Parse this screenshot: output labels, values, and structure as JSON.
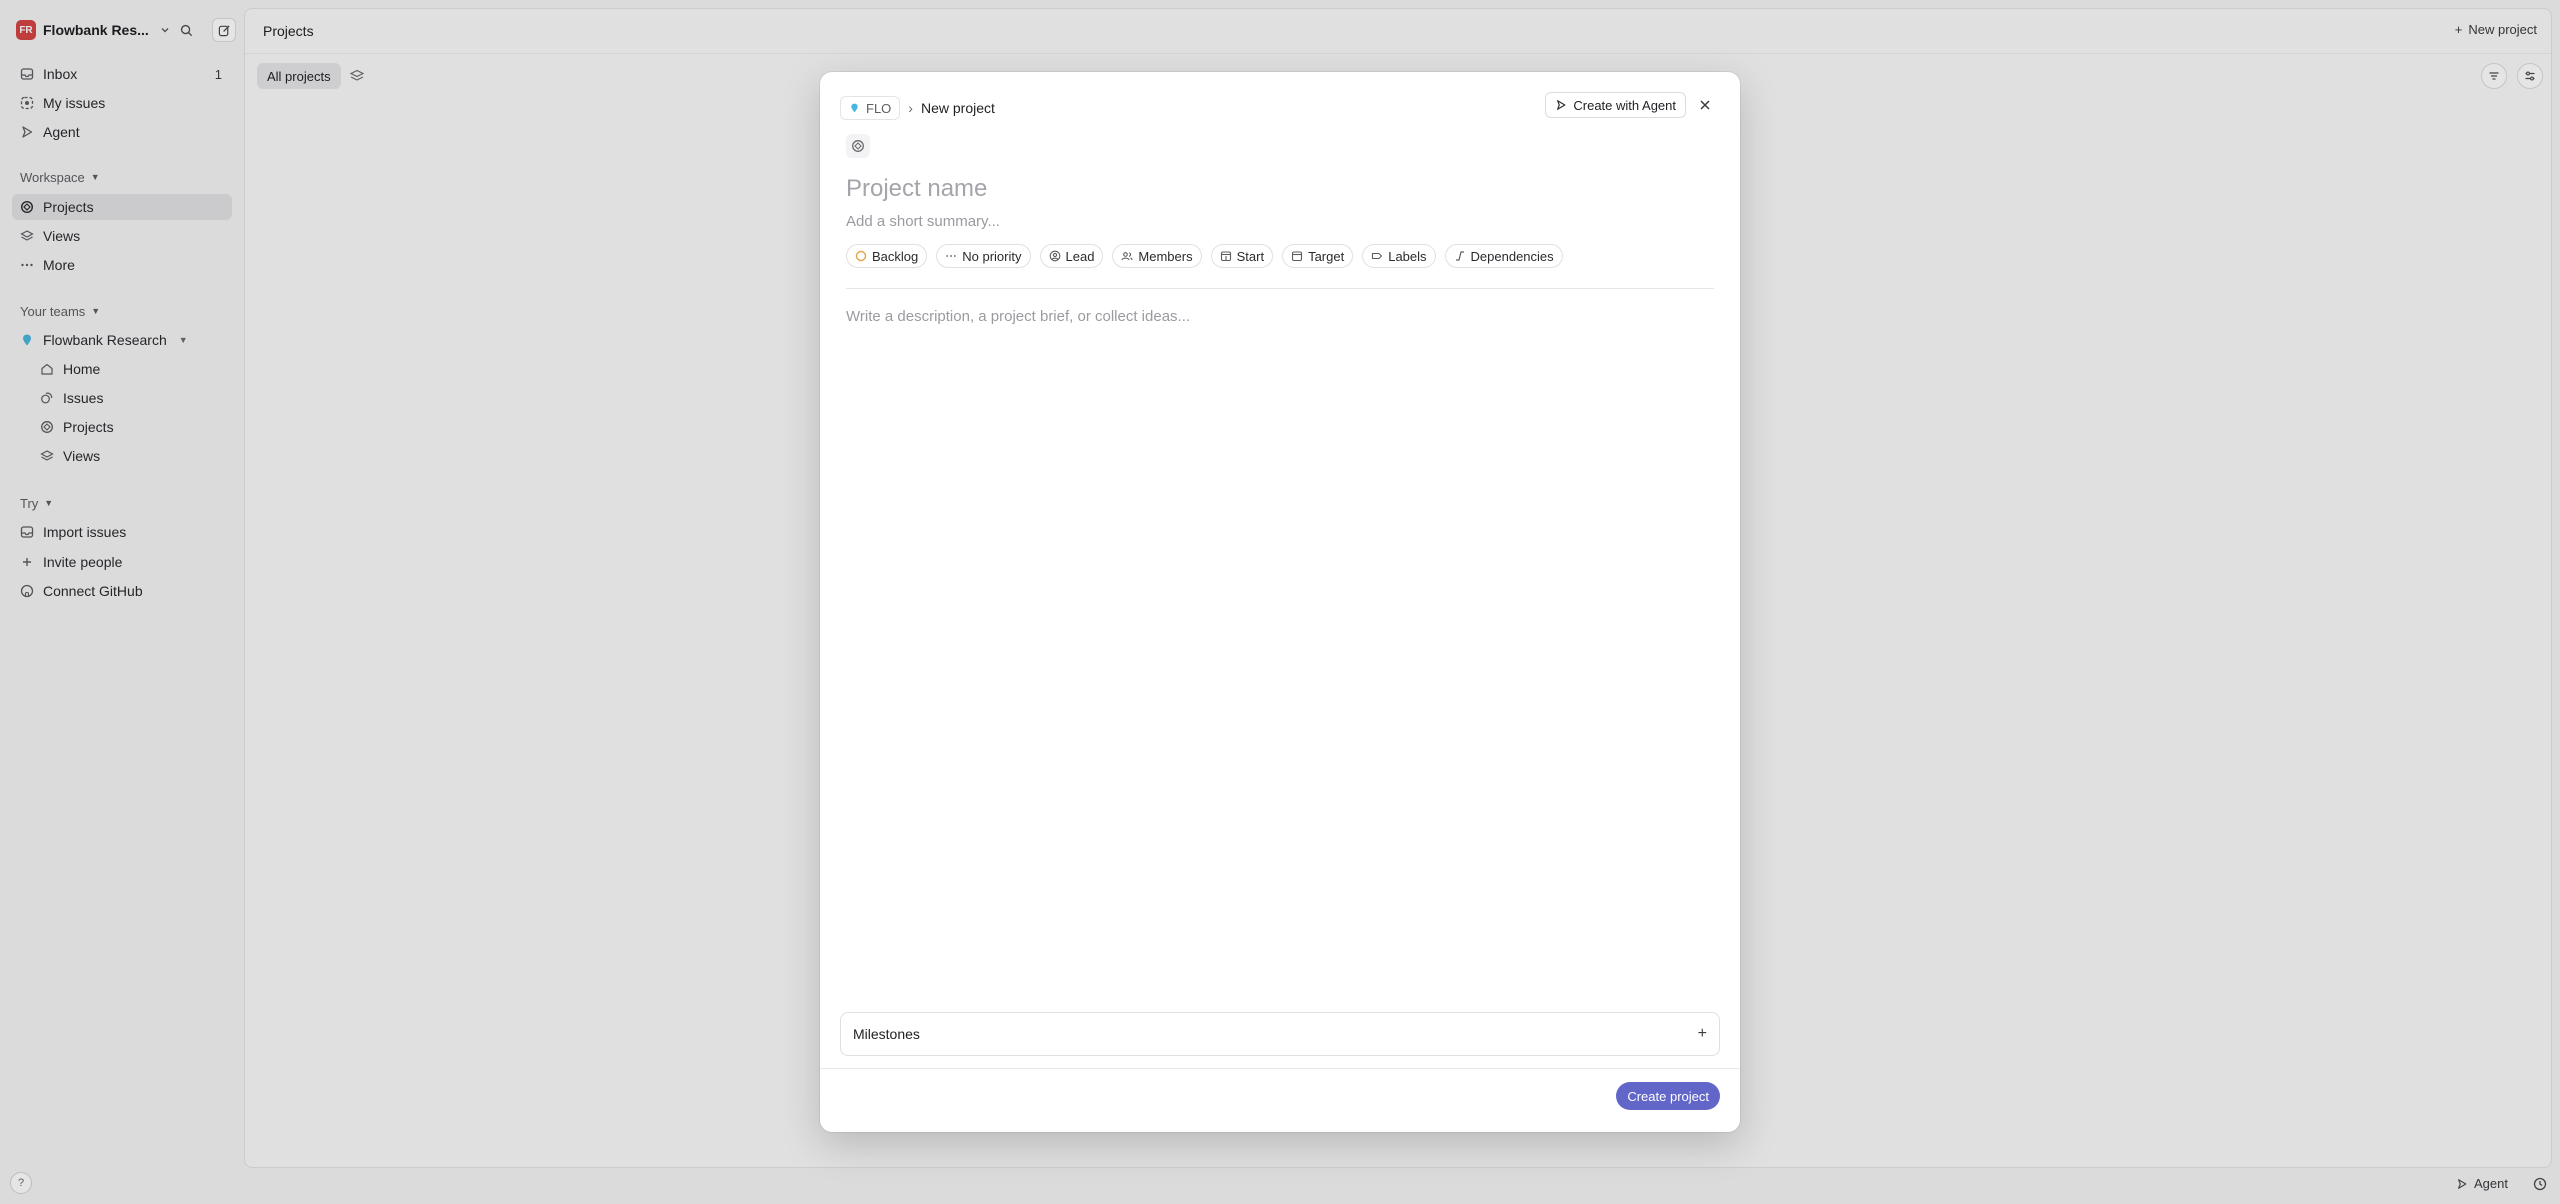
{
  "workspace": {
    "initials": "FR",
    "name": "Flowbank Res...",
    "avatar_color": "#d64545"
  },
  "sidebar": {
    "top_items": [
      {
        "label": "Inbox",
        "count": "1"
      },
      {
        "label": "My issues"
      },
      {
        "label": "Agent"
      }
    ],
    "workspace_section": {
      "label": "Workspace",
      "items": [
        {
          "label": "Projects"
        },
        {
          "label": "Views"
        },
        {
          "label": "More"
        }
      ]
    },
    "teams_section": {
      "label": "Your teams",
      "team_name": "Flowbank Research",
      "items": [
        {
          "label": "Home"
        },
        {
          "label": "Issues"
        },
        {
          "label": "Projects"
        },
        {
          "label": "Views"
        }
      ]
    },
    "try_section": {
      "label": "Try",
      "items": [
        {
          "label": "Import issues"
        },
        {
          "label": "Invite people"
        },
        {
          "label": "Connect GitHub"
        }
      ]
    },
    "help_label": "?"
  },
  "main": {
    "title": "Projects",
    "new_project_label": "New project",
    "filter_chip": "All projects"
  },
  "modal": {
    "team_key": "FLO",
    "breadcrumb_current": "New project",
    "agent_button": "Create with Agent",
    "name_placeholder": "Project name",
    "summary_placeholder": "Add a short summary...",
    "properties": [
      "Backlog",
      "No priority",
      "Lead",
      "Members",
      "Start",
      "Target",
      "Labels",
      "Dependencies"
    ],
    "description_placeholder": "Write a description, a project brief, or collect ideas...",
    "milestones_label": "Milestones",
    "create_button": "Create project",
    "accent_color": "#6366c9",
    "backlog_color": "#e2a54a"
  },
  "bottom_bar": {
    "agent_label": "Agent"
  }
}
